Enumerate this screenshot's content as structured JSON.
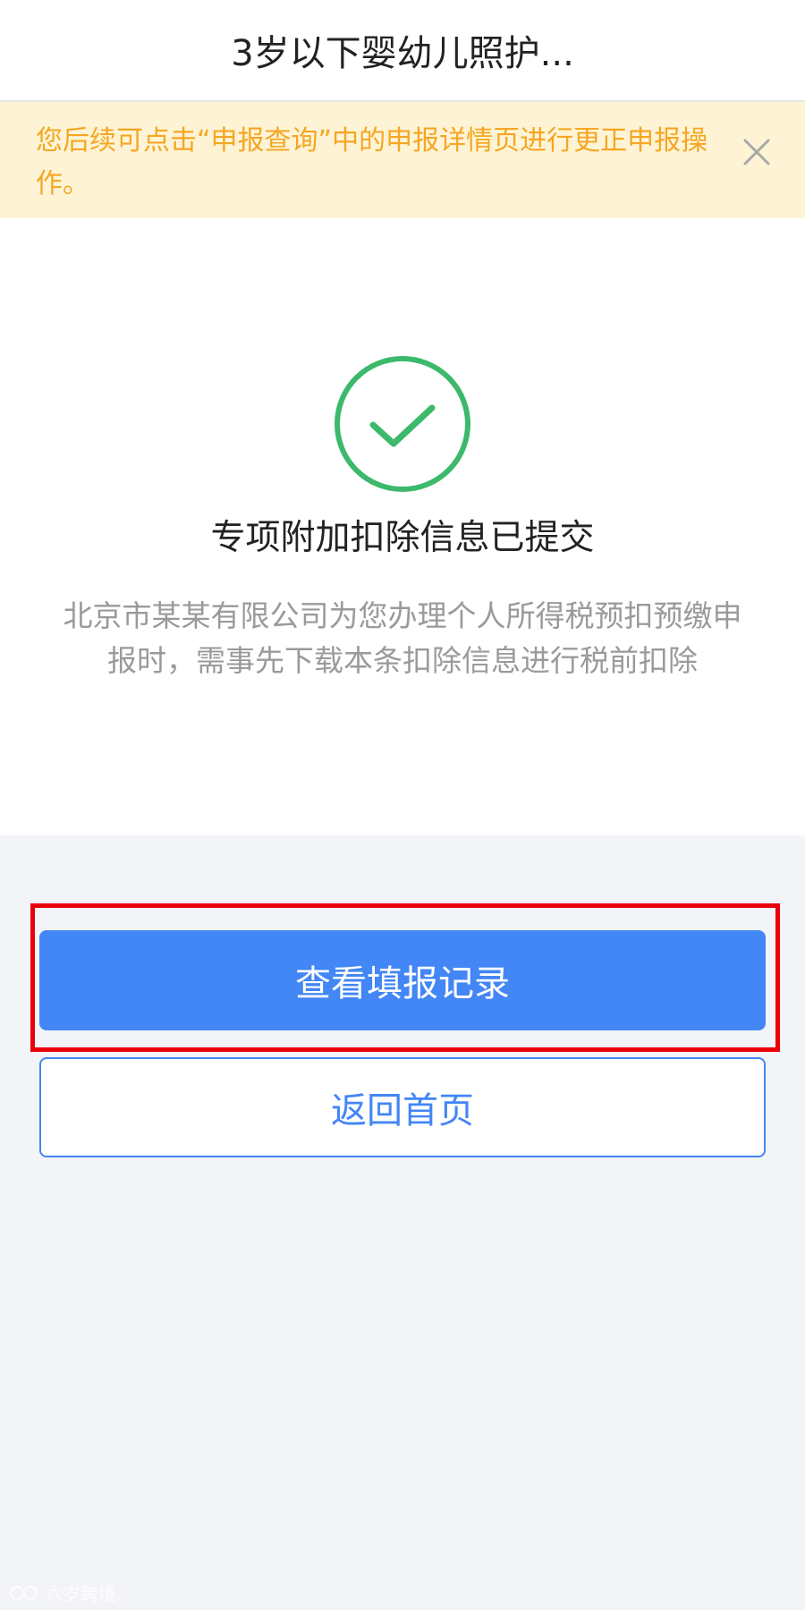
{
  "header": {
    "title": "3岁以下婴幼儿照护..."
  },
  "notice": {
    "text": "您后续可点击“申报查询”中的申报详情页进行更正申报操作。",
    "close_icon": "close-icon"
  },
  "result": {
    "icon": "check-circle-icon",
    "title": "专项附加扣除信息已提交",
    "description": "北京市某某有限公司为您办理个人所得税预扣预缴申报时，需事先下载本条扣除信息进行税前扣除"
  },
  "actions": {
    "view_records_label": "查看填报记录",
    "back_home_label": "返回首页"
  },
  "watermark": {
    "text": "六岁跨境"
  },
  "colors": {
    "accent": "#4386f5",
    "success": "#3cb96b",
    "notice_bg": "#fef4d5",
    "notice_text": "#f5a623",
    "highlight": "#e8000b"
  }
}
